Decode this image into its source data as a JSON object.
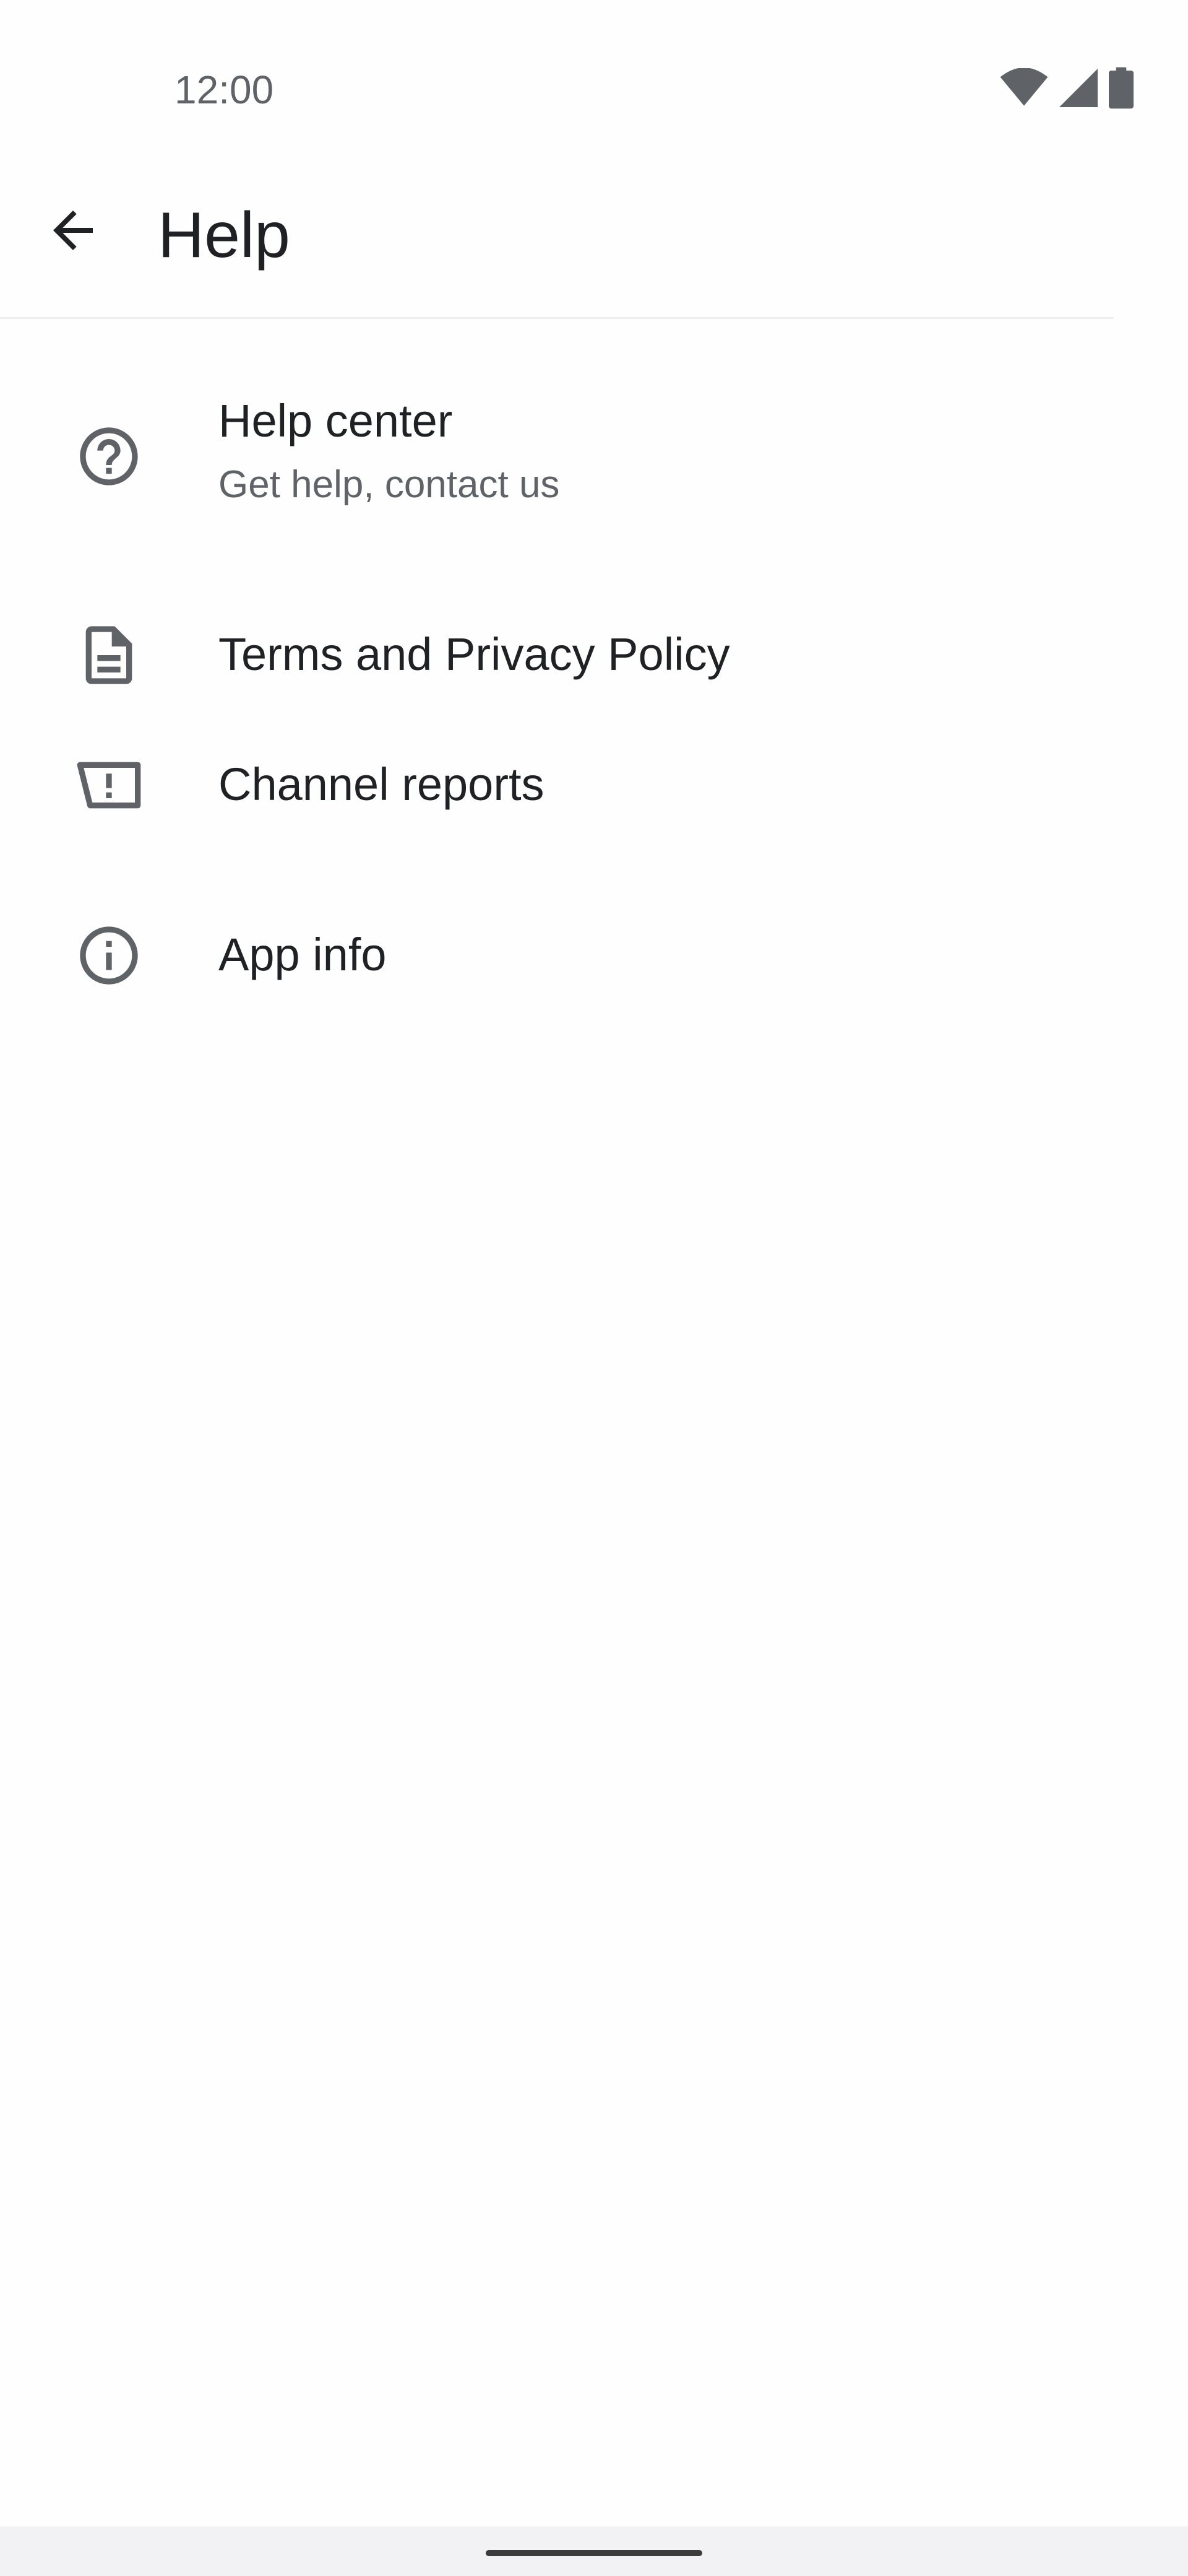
{
  "status_bar": {
    "time": "12:00",
    "icons": [
      "wifi-icon",
      "cellular-signal-icon",
      "battery-icon"
    ]
  },
  "app_bar": {
    "back_icon": "arrow-back-icon",
    "title": "Help"
  },
  "menu": {
    "items": [
      {
        "icon": "help-circle-icon",
        "title": "Help center",
        "subtitle": "Get help, contact us"
      },
      {
        "icon": "document-icon",
        "title": "Terms and Privacy Policy"
      },
      {
        "icon": "report-flag-icon",
        "title": "Channel reports"
      },
      {
        "icon": "info-circle-icon",
        "title": "App info"
      }
    ]
  },
  "colors": {
    "background": "#fefefe",
    "text_primary": "#202124",
    "text_secondary": "#5f6368",
    "icon": "#5f6368",
    "divider": "#eeeeee",
    "nav_bar": "#f2f2f4"
  }
}
